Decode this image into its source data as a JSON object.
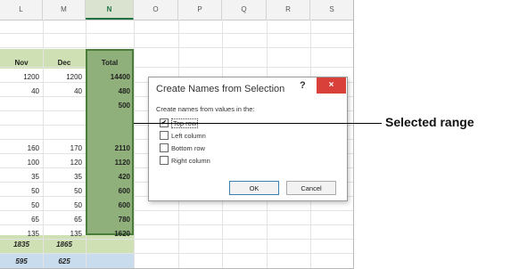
{
  "sheet": {
    "columns": [
      "L",
      "M",
      "N",
      "O",
      "P",
      "Q",
      "R",
      "S"
    ],
    "active_column": "N",
    "headers": {
      "nov": "Nov",
      "dec": "Dec",
      "total": "Total"
    },
    "rows": [
      {
        "nov": "1200",
        "dec": "1200",
        "total": "14400"
      },
      {
        "nov": "40",
        "dec": "40",
        "total": "480"
      },
      {
        "nov": "",
        "dec": "",
        "total": "500"
      },
      {
        "nov": "",
        "dec": "",
        "total": ""
      },
      {
        "nov": "",
        "dec": "",
        "total": ""
      },
      {
        "nov": "160",
        "dec": "170",
        "total": "2110"
      },
      {
        "nov": "100",
        "dec": "120",
        "total": "1120"
      },
      {
        "nov": "35",
        "dec": "35",
        "total": "420"
      },
      {
        "nov": "50",
        "dec": "50",
        "total": "600"
      },
      {
        "nov": "50",
        "dec": "50",
        "total": "600"
      },
      {
        "nov": "65",
        "dec": "65",
        "total": "780"
      },
      {
        "nov": "135",
        "dec": "135",
        "total": "1620"
      }
    ],
    "summary_green": {
      "nov": "1835",
      "dec": "1865"
    },
    "summary_blue": {
      "nov": "595",
      "dec": "625"
    }
  },
  "dialog": {
    "title": "Create Names from Selection",
    "help": "?",
    "close": "×",
    "prompt": "Create names from values in the:",
    "options": [
      {
        "label": "Top row",
        "checked": true
      },
      {
        "label": "Left column",
        "checked": false
      },
      {
        "label": "Bottom row",
        "checked": false
      },
      {
        "label": "Right column",
        "checked": false
      }
    ],
    "ok_label": "OK",
    "cancel_label": "Cancel"
  },
  "callout": {
    "label": "Selected range"
  },
  "colors": {
    "selection": "#8fb07a",
    "green_band": "#cfe0b4",
    "blue_band": "#c8dced",
    "close": "#d9403a"
  }
}
